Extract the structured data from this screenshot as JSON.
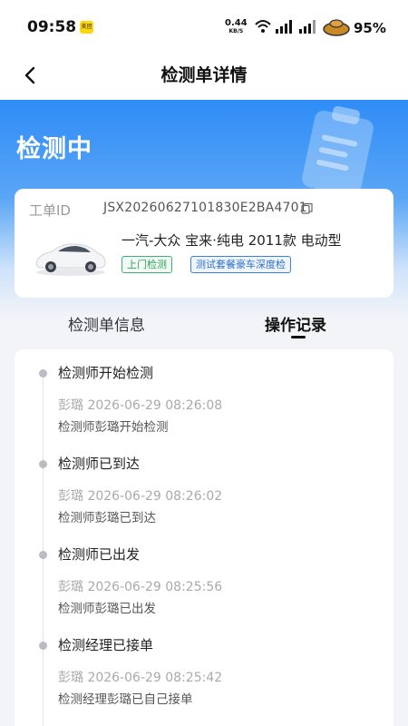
{
  "status_bar": {
    "time": "09:58",
    "app_badge": "美团",
    "net_speed_value": "0.44",
    "net_speed_unit": "KB/S",
    "battery_pct": "95%"
  },
  "nav": {
    "title": "检测单详情"
  },
  "hero": {
    "status": "检测中"
  },
  "order": {
    "id_label": "工单ID",
    "id_value": "JSX20260627101830E2BA4701",
    "car_model": "一汽-大众 宝来·纯电 2011款 电动型",
    "tags": [
      "上门检测",
      "测试套餐豪车深度检"
    ]
  },
  "tabs": [
    {
      "label": "检测单信息",
      "active": false
    },
    {
      "label": "操作记录",
      "active": true
    }
  ],
  "logs": [
    {
      "title": "检测师开始检测",
      "meta": "彭璐 2026-06-29 08:26:08",
      "desc": "检测师彭璐开始检测"
    },
    {
      "title": "检测师已到达",
      "meta": "彭璐 2026-06-29 08:26:02",
      "desc": "检测师彭璐已到达"
    },
    {
      "title": "检测师已出发",
      "meta": "彭璐 2026-06-29 08:25:56",
      "desc": "检测师彭璐已出发"
    },
    {
      "title": "检测经理已接单",
      "meta": "彭璐 2026-06-29 08:25:42",
      "desc": "检测经理彭璐已自己接单"
    }
  ],
  "colors": {
    "brand_blue": "#2f8cf7",
    "tag_green": "#2e9f5e",
    "tag_blue": "#2f6fc4"
  },
  "icons": [
    "back-arrow-icon",
    "copy-icon",
    "clipboard-illustration",
    "car-image",
    "wifi-icon",
    "signal-icon",
    "battery-icon"
  ]
}
